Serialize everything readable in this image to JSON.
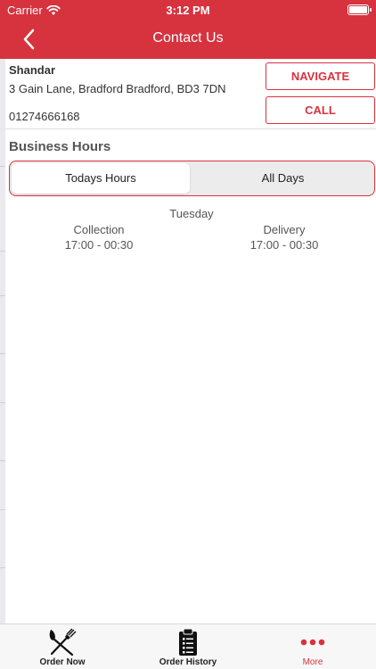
{
  "status_bar": {
    "carrier": "Carrier",
    "time": "3:12 PM"
  },
  "nav": {
    "title": "Contact Us",
    "back_icon": "chevron-left-icon"
  },
  "restaurant": {
    "name": "Shandar",
    "address": "3 Gain Lane, Bradford Bradford, BD3 7DN",
    "phone": "01274666168"
  },
  "actions": {
    "navigate": "NAVIGATE",
    "call": "CALL"
  },
  "business_hours": {
    "heading": "Business Hours",
    "segments": [
      "Todays Hours",
      "All Days"
    ],
    "selected_segment": "Todays Hours",
    "day": "Tuesday",
    "collection_label": "Collection",
    "collection_hours": "17:00 - 00:30",
    "delivery_label": "Delivery",
    "delivery_hours": "17:00 - 00:30"
  },
  "tabs": [
    {
      "label": "Order Now",
      "icon": "fork-knife-icon"
    },
    {
      "label": "Order History",
      "icon": "clipboard-list-icon"
    },
    {
      "label": "More",
      "icon": "more-dots-icon",
      "active": true
    }
  ],
  "colors": {
    "accent": "#d6333f",
    "tab_bar_bg": "#f7f7f7"
  }
}
